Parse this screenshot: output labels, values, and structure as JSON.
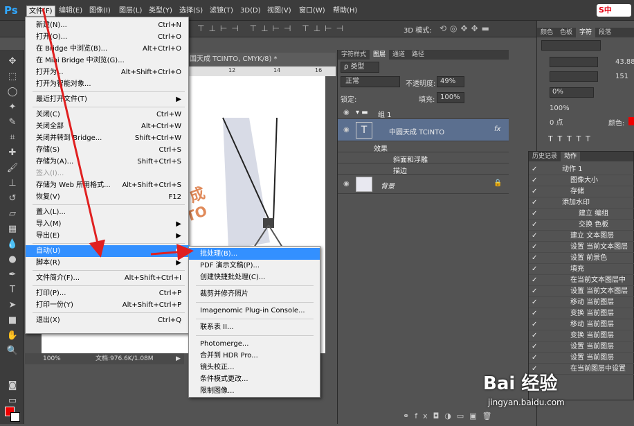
{
  "app": {
    "logo": "Ps"
  },
  "menubar": [
    {
      "label": "文件(F)",
      "active": true
    },
    {
      "label": "编辑(E)"
    },
    {
      "label": "图像(I)"
    },
    {
      "label": "图层(L)"
    },
    {
      "label": "类型(Y)"
    },
    {
      "label": "选择(S)"
    },
    {
      "label": "滤镜(T)"
    },
    {
      "label": "3D(D)"
    },
    {
      "label": "视图(V)"
    },
    {
      "label": "窗口(W)"
    },
    {
      "label": "帮助(H)"
    }
  ],
  "optbar": {
    "mode_label": "3D 模式:"
  },
  "document": {
    "tab": "国天成 TCINTO, CMYK/8) *",
    "zoom": "100%",
    "doc_info": "文档:976.6K/1.08M",
    "ruler_marks": [
      "12",
      "14",
      "16"
    ]
  },
  "file_menu": [
    {
      "label": "新建(N)...",
      "shortcut": "Ctrl+N"
    },
    {
      "label": "打开(O)...",
      "shortcut": "Ctrl+O"
    },
    {
      "label": "在 Bridge 中浏览(B)...",
      "shortcut": "Alt+Ctrl+O"
    },
    {
      "label": "在 Mini Bridge 中浏览(G)...",
      "shortcut": ""
    },
    {
      "label": "打开为...",
      "shortcut": "Alt+Shift+Ctrl+O"
    },
    {
      "label": "打开为智能对象...",
      "shortcut": ""
    },
    {
      "label": "最近打开文件(T)",
      "shortcut": "▶"
    },
    {
      "label": "关闭(C)",
      "shortcut": "Ctrl+W"
    },
    {
      "label": "关闭全部",
      "shortcut": "Alt+Ctrl+W"
    },
    {
      "label": "关闭并转到 Bridge...",
      "shortcut": "Shift+Ctrl+W"
    },
    {
      "label": "存储(S)",
      "shortcut": "Ctrl+S"
    },
    {
      "label": "存储为(A)...",
      "shortcut": "Shift+Ctrl+S"
    },
    {
      "label": "签入(I)...",
      "shortcut": ""
    },
    {
      "label": "存储为 Web 所用格式...",
      "shortcut": "Alt+Shift+Ctrl+S"
    },
    {
      "label": "恢复(V)",
      "shortcut": "F12"
    },
    {
      "label": "置入(L)...",
      "shortcut": ""
    },
    {
      "label": "导入(M)",
      "shortcut": "▶"
    },
    {
      "label": "导出(E)",
      "shortcut": "▶"
    },
    {
      "label": "自动(U)",
      "shortcut": "▶"
    },
    {
      "label": "脚本(R)",
      "shortcut": "▶"
    },
    {
      "label": "文件简介(F)...",
      "shortcut": "Alt+Shift+Ctrl+I"
    },
    {
      "label": "打印(P)...",
      "shortcut": "Ctrl+P"
    },
    {
      "label": "打印一份(Y)",
      "shortcut": "Alt+Shift+Ctrl+P"
    },
    {
      "label": "退出(X)",
      "shortcut": "Ctrl+Q"
    }
  ],
  "auto_submenu": [
    {
      "label": "批处理(B)..."
    },
    {
      "label": "PDF 演示文稿(P)..."
    },
    {
      "label": "创建快捷批处理(C)..."
    },
    {
      "label": "裁剪并修齐照片"
    },
    {
      "label": "Imagenomic Plug-in Console..."
    },
    {
      "label": "联系表 II..."
    },
    {
      "label": "Photomerge..."
    },
    {
      "label": "合并到 HDR Pro..."
    },
    {
      "label": "镜头校正..."
    },
    {
      "label": "条件模式更改..."
    },
    {
      "label": "限制图像..."
    }
  ],
  "layers_panel": {
    "tabs": [
      "字符样式",
      "图层",
      "通道",
      "路径"
    ],
    "filter": "ρ 类型",
    "blend_mode": "正常",
    "opacity_label": "不透明度:",
    "opacity": "49%",
    "lock_label": "锁定:",
    "fill_label": "填充:",
    "fill": "100%",
    "layers": [
      {
        "name": "组 1"
      },
      {
        "name": "中圆天成 TCINTO",
        "fx": "fx"
      },
      {
        "name": "效果"
      },
      {
        "name": "斜面和浮雕"
      },
      {
        "name": "描边"
      },
      {
        "name": "背景"
      }
    ]
  },
  "char_panel": {
    "tabs": [
      "颜色",
      "色板",
      "字符",
      "段落"
    ],
    "size": "43.88",
    "tracking": "151",
    "scale_pct": "0%",
    "vscale": "100%",
    "baseline": "0 点",
    "color_label": "颜色:"
  },
  "actions_panel": {
    "tabs": [
      "历史记录",
      "动作"
    ],
    "rows": [
      "动作 1",
      "图像大小",
      "存储",
      "添加水印",
      "建立 编组",
      "交换 色板",
      "建立 文本图层",
      "设置 当前文本图层",
      "设置 前景色",
      "填充",
      "在当前文本图层中",
      "设置 当前文本图层",
      "移动 当前图层",
      "变换 当前图层",
      "移动 当前图层",
      "变换 当前图层",
      "设置 当前图层",
      "设置 当前图层",
      "在当前图层中设置"
    ]
  },
  "watermark": {
    "brand": "Bai 经验",
    "url": "jingyan.baidu.com"
  },
  "ime": {
    "label": "S中"
  }
}
